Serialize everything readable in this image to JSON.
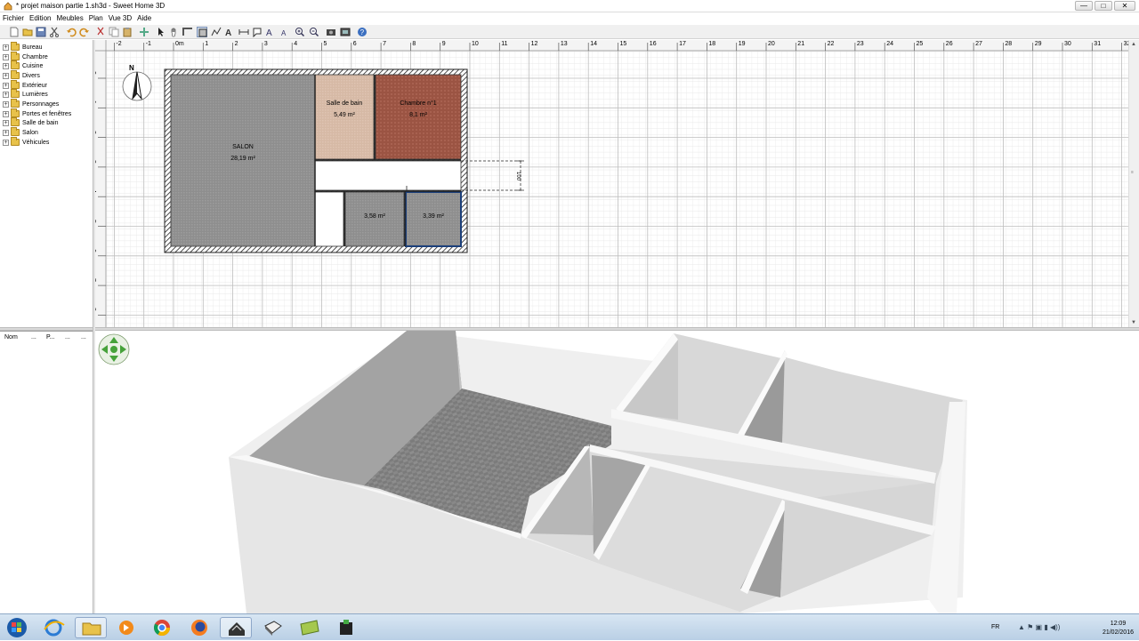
{
  "window": {
    "title": "* projet maison partie 1.sh3d - Sweet Home 3D",
    "buttons": [
      "—",
      "□",
      "✕"
    ]
  },
  "menu": [
    "Fichier",
    "Edition",
    "Meubles",
    "Plan",
    "Vue 3D",
    "Aide"
  ],
  "catalog": {
    "items": [
      "Bureau",
      "Chambre",
      "Cuisine",
      "Divers",
      "Extérieur",
      "Lumières",
      "Personnages",
      "Portes et fenêtres",
      "Salle de bain",
      "Salon",
      "Véhicules"
    ]
  },
  "furniture_list": {
    "columns": [
      "Nom",
      "...",
      "P...",
      "...",
      "..."
    ]
  },
  "plan": {
    "compass_label": "N",
    "ruler_top": [
      "-2",
      "-1",
      "0m",
      "1",
      "2",
      "3",
      "4",
      "5",
      "6",
      "7",
      "8",
      "9",
      "10",
      "11",
      "12",
      "13",
      "14",
      "15",
      "16",
      "17",
      "18",
      "19",
      "20",
      "21",
      "22",
      "23",
      "24",
      "25",
      "26",
      "27",
      "28",
      "29",
      "30",
      "31",
      "32"
    ],
    "ruler_left": [
      "0m",
      "1",
      "2",
      "3",
      "4",
      "5",
      "6",
      "7",
      "8"
    ],
    "rooms": [
      {
        "name": "SALON",
        "area": "28,19 m²"
      },
      {
        "name": "Salle de bain",
        "area": "5,49 m²"
      },
      {
        "name": "Chambre n°1",
        "area": "8,1 m²"
      },
      {
        "name": "",
        "area": "3,58 m²"
      },
      {
        "name": "",
        "area": "3,39 m²"
      }
    ],
    "dimension_label": "100"
  },
  "taskbar": {
    "language": "FR",
    "time": "12:09",
    "date": "21/02/2016"
  }
}
